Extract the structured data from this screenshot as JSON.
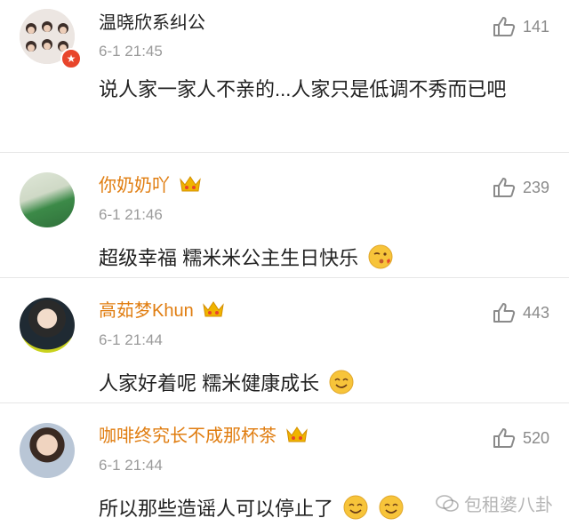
{
  "comments": [
    {
      "name": "温晓欣系纠公",
      "time": "6-1 21:45",
      "likes": "141",
      "text": "说人家一家人不亲的...人家只是低调不秀而已吧",
      "verified": true
    },
    {
      "name": "你奶奶吖",
      "time": "6-1 21:46",
      "likes": "239",
      "text": "超级幸福 糯米米公主生日快乐"
    },
    {
      "name": "高茹梦Khun",
      "time": "6-1 21:44",
      "likes": "443",
      "text": "人家好着呢 糯米健康成长"
    },
    {
      "name": "咖啡终究长不成那杯茶",
      "time": "6-1 21:44",
      "likes": "520",
      "text": "所以那些造谣人可以停止了"
    }
  ],
  "watermark": "包租婆八卦",
  "colors": {
    "vip_name": "#e07d10",
    "crown": "#f0b400",
    "verified_badge": "#e8452b"
  }
}
